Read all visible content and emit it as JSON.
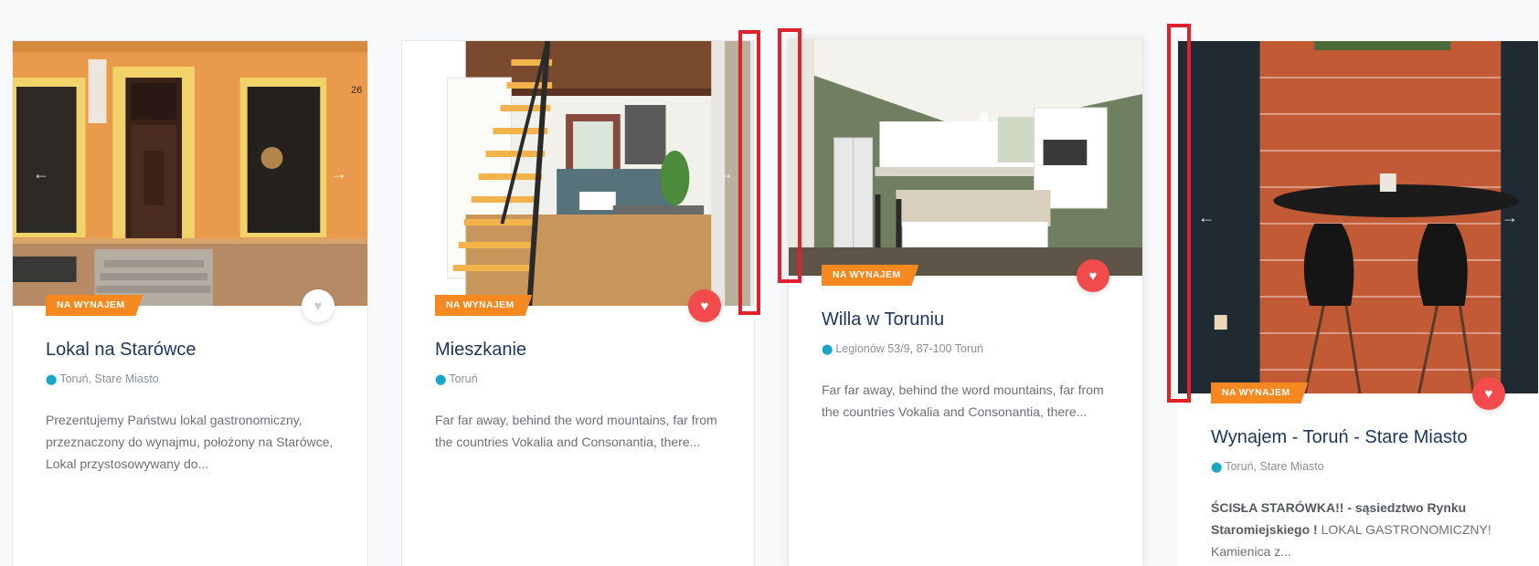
{
  "cards": [
    {
      "badge": "NA WYNAJEM",
      "title": "Lokal na Starówce",
      "location": "Toruń, Stare Miasto",
      "description": "Prezentujemy Państwu lokal gastronomiczny, przeznaczony do wynajmu, położony na Starówce, Lokal przystosowywany do...",
      "favorite": false,
      "photo_caption": "26"
    },
    {
      "badge": "NA WYNAJEM",
      "title": "Mieszkanie",
      "location": "Toruń",
      "description": "Far far away, behind the word mountains, far from the countries Vokalia and Consonantia, there...",
      "favorite": true
    },
    {
      "badge": "NA WYNAJEM",
      "title": "Willa w Toruniu",
      "location": "Legionów 53/9, 87-100 Toruń",
      "description": "Far far away, behind the word mountains, far from the countries Vokalia and Consonantia, there...",
      "favorite": true
    },
    {
      "badge": "NA WYNAJEM",
      "title": "Wynajem - Toruń - Stare Miasto",
      "location": "Toruń, Stare Miasto",
      "description_bold": "ŚCISŁA STARÓWKA!! - sąsiedztwo Rynku Staromiejskiego !",
      "description_rest": " LOKAL GASTRONOMICZNY! Kamienica z...",
      "favorite": true
    }
  ],
  "slider_arrows": {
    "prev": "←",
    "next": "→"
  },
  "icons": {
    "heart": "heart-icon",
    "pin": "map-pin-icon",
    "prev": "arrow-left-icon",
    "next": "arrow-right-icon"
  },
  "colors": {
    "badge": "#f5891f",
    "favorite_active": "#f14b4b",
    "title": "#1c355e",
    "pin": "#18a7c8",
    "highlight_marker": "#e0202a"
  }
}
